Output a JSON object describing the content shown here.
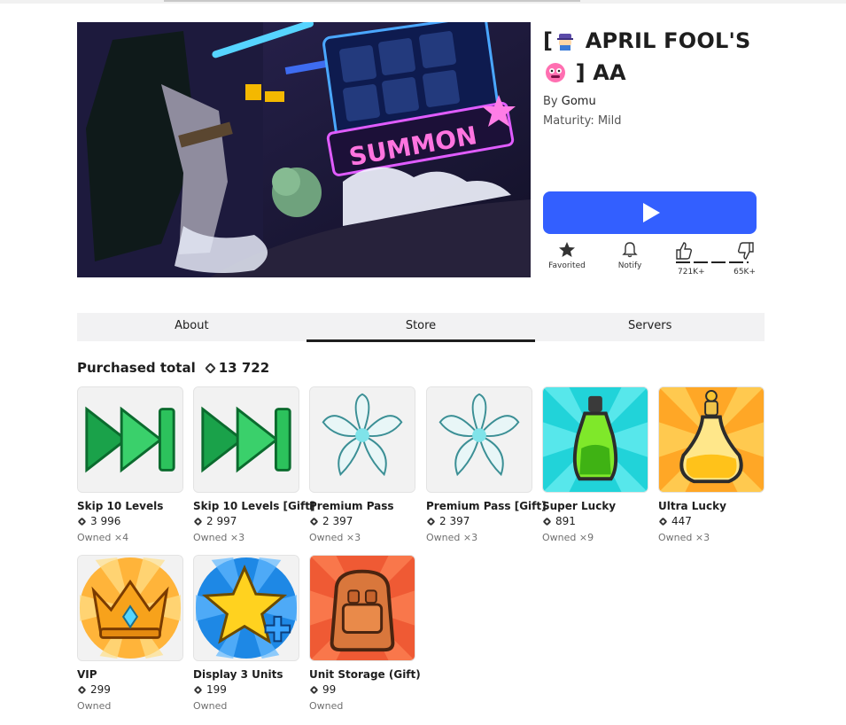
{
  "game": {
    "title_part1": "[",
    "title_part2": "APRIL FOOL'S",
    "title_part3": "] AA",
    "by_prefix": "By",
    "creator": "Gomu",
    "maturity": "Maturity: Mild",
    "hero_sign_text": "SUMMON"
  },
  "actions": {
    "favorite_label": "Favorited",
    "notify_label": "Notify",
    "likes": "721K+",
    "dislikes": "65K+"
  },
  "tabs": [
    "About",
    "Store",
    "Servers"
  ],
  "active_tab": "Store",
  "store": {
    "purchased_label": "Purchased total",
    "purchased_total": "13 722",
    "items": [
      {
        "name": "Skip 10 Levels",
        "price": "3 996",
        "owned": "Owned ×4",
        "icon": "fast-forward-icon"
      },
      {
        "name": "Skip 10 Levels [Gift]",
        "price": "2 997",
        "owned": "Owned ×3",
        "icon": "fast-forward-icon"
      },
      {
        "name": "Premium Pass",
        "price": "2 397",
        "owned": "Owned ×3",
        "icon": "lotus-flower-icon"
      },
      {
        "name": "Premium Pass [Gift]",
        "price": "2 397",
        "owned": "Owned ×3",
        "icon": "lotus-flower-icon"
      },
      {
        "name": "Super Lucky",
        "price": "891",
        "owned": "Owned ×9",
        "icon": "green-potion-icon"
      },
      {
        "name": "Ultra Lucky",
        "price": "447",
        "owned": "Owned ×3",
        "icon": "gold-potion-icon"
      },
      {
        "name": "VIP",
        "price": "299",
        "owned": "Owned",
        "icon": "crown-icon"
      },
      {
        "name": "Display 3 Units",
        "price": "199",
        "owned": "Owned",
        "icon": "star-plus-icon"
      },
      {
        "name": "Unit Storage (Gift)",
        "price": "99",
        "owned": "Owned",
        "icon": "backpack-icon"
      }
    ]
  },
  "colors": {
    "play_button": "#335fff",
    "text": "#1e1e1e",
    "muted": "#707070"
  }
}
